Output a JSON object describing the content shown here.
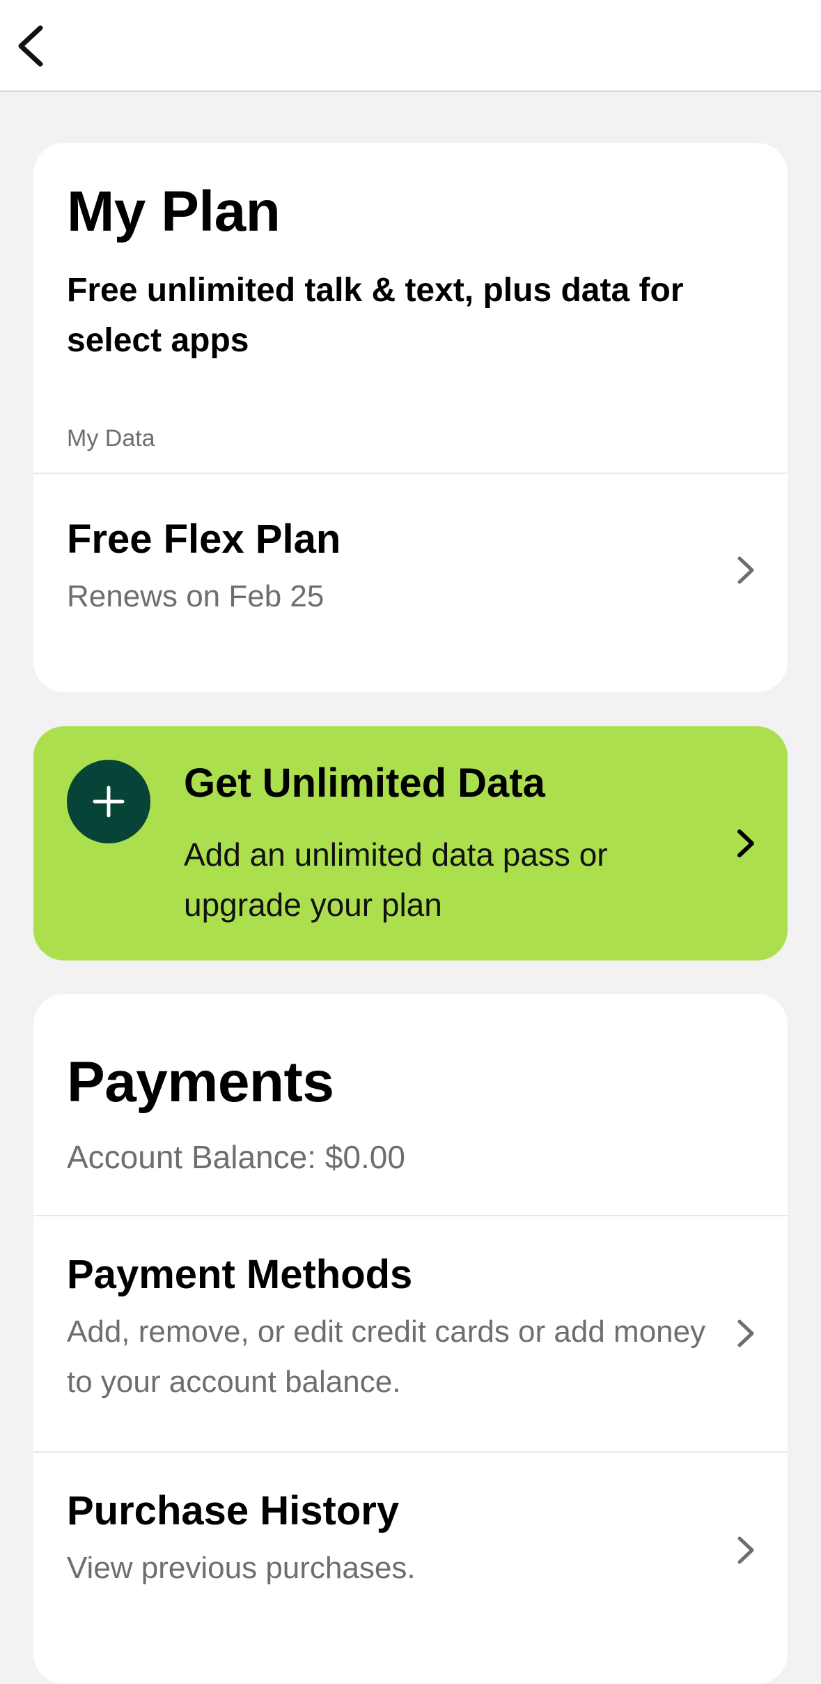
{
  "nav": {
    "back_icon": "chevron-left-icon"
  },
  "plan": {
    "title": "My Plan",
    "subtitle": "Free unlimited talk & text, plus data for select apps",
    "data_label": "My Data",
    "plan_name": "Free Flex Plan",
    "renewal": "Renews on Feb 25"
  },
  "promo": {
    "icon": "plus-icon",
    "title": "Get Unlimited Data",
    "description": "Add an unlimited data pass or upgrade your plan",
    "background_color": "#abdf4e",
    "icon_color": "#074336"
  },
  "payments": {
    "title": "Payments",
    "balance": "Account Balance: $0.00",
    "items": [
      {
        "title": "Payment Methods",
        "description": "Add, remove, or edit credit cards or add money to your account balance."
      },
      {
        "title": "Purchase History",
        "description": "View previous purchases."
      }
    ]
  }
}
